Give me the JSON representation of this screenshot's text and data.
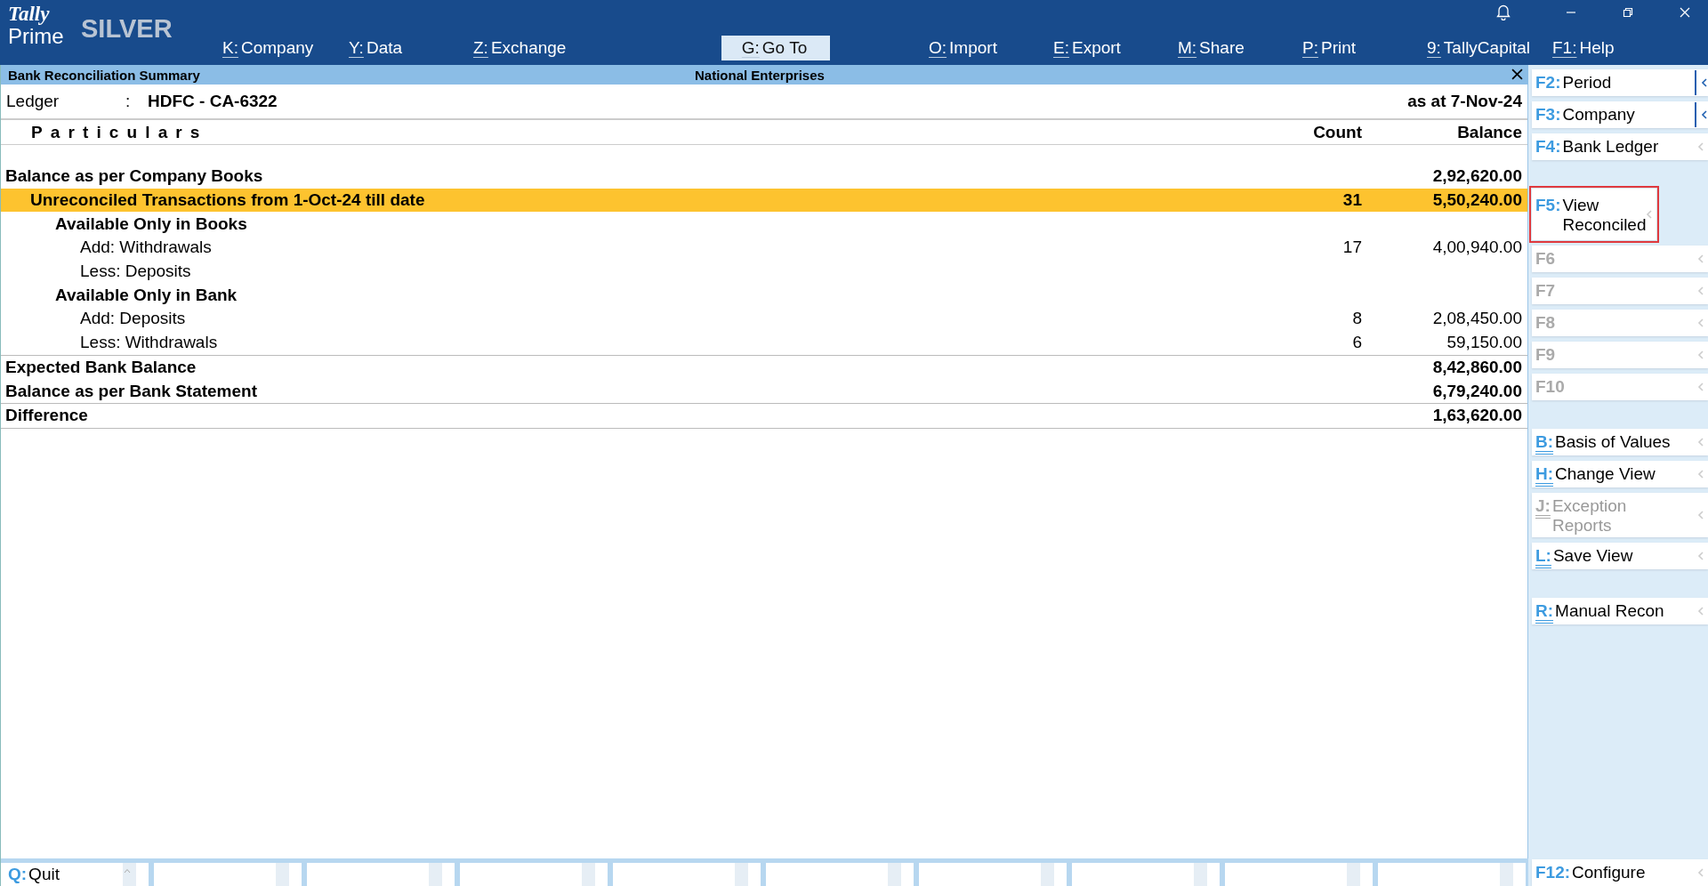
{
  "logo": {
    "brand": "Tally",
    "product": "Prime",
    "edition": "SILVER"
  },
  "top_menu": [
    {
      "key": "K:",
      "label": "Company",
      "selected": false
    },
    {
      "key": "Y:",
      "label": "Data",
      "selected": false
    },
    {
      "key": "Z:",
      "label": "Exchange",
      "selected": false
    },
    {
      "key": "G:",
      "label": "Go To",
      "selected": true
    },
    {
      "key": "O:",
      "label": "Import",
      "selected": false
    },
    {
      "key": "E:",
      "label": "Export",
      "selected": false
    },
    {
      "key": "M:",
      "label": "Share",
      "selected": false
    },
    {
      "key": "P:",
      "label": "Print",
      "selected": false
    },
    {
      "key": "9:",
      "label": "TallyCapital",
      "selected": false
    },
    {
      "key": "F1:",
      "label": "Help",
      "selected": false
    }
  ],
  "report": {
    "title": "Bank Reconciliation Summary",
    "company": "National Enterprises",
    "ledger_label": "Ledger",
    "ledger_separator": ":",
    "ledger_value": "HDFC - CA-6322",
    "as_at": "as at 7-Nov-24",
    "columns": [
      "Particulars",
      "Count",
      "Balance"
    ],
    "sections": [
      {
        "rows": [
          {
            "label": "Balance as per Company Books",
            "balance": "2,92,620.00",
            "selected": false,
            "children": [
              {
                "label": "Unreconciled Transactions from 1-Oct-24 till date",
                "count": "31",
                "balance": "5,50,240.00",
                "selected": true,
                "children": [
                  {
                    "label": "Available Only in Books",
                    "selected": false,
                    "children": [
                      {
                        "label": "Add: Withdrawals",
                        "count": "17",
                        "balance": "4,00,940.00",
                        "selected": false
                      },
                      {
                        "label": "Less: Deposits",
                        "selected": false
                      }
                    ]
                  },
                  {
                    "label": "Available Only in Bank",
                    "selected": false,
                    "children": [
                      {
                        "label": "Add: Deposits",
                        "count": "8",
                        "balance": "2,08,450.00",
                        "selected": false
                      },
                      {
                        "label": "Less: Withdrawals",
                        "count": "6",
                        "balance": "59,150.00",
                        "selected": false
                      }
                    ]
                  }
                ]
              }
            ]
          }
        ]
      },
      {
        "rows": [
          {
            "label": "Expected Bank Balance",
            "balance": "8,42,860.00",
            "selected": false
          },
          {
            "label": "Balance as per Bank Statement",
            "balance": "6,79,240.00",
            "selected": false
          }
        ]
      },
      {
        "rows": [
          {
            "label": "Difference",
            "balance": "1,63,620.00",
            "selected": false
          }
        ]
      }
    ]
  },
  "side_panel": [
    [
      {
        "key": "F2:",
        "label": "Period",
        "disabled": false,
        "expanded": true,
        "highlighted": false,
        "underline": false
      },
      {
        "key": "F3:",
        "label": "Company",
        "disabled": false,
        "expanded": true,
        "highlighted": false,
        "underline": false
      },
      {
        "key": "F4:",
        "label": "Bank Ledger",
        "disabled": false,
        "expanded": false,
        "highlighted": false,
        "underline": false
      }
    ],
    [
      {
        "key": "F5:",
        "label": "View Reconciled",
        "disabled": false,
        "expanded": false,
        "highlighted": true,
        "underline": false
      },
      {
        "key": "F6",
        "disabled": true,
        "expanded": false,
        "highlighted": false,
        "underline": false
      },
      {
        "key": "F7",
        "disabled": true,
        "expanded": false,
        "highlighted": false,
        "underline": false
      },
      {
        "key": "F8",
        "disabled": true,
        "expanded": false,
        "highlighted": false,
        "underline": false
      },
      {
        "key": "F9",
        "disabled": true,
        "expanded": false,
        "highlighted": false,
        "underline": false
      },
      {
        "key": "F10",
        "disabled": true,
        "expanded": false,
        "highlighted": false,
        "underline": false
      }
    ],
    [
      {
        "key": "B:",
        "label": "Basis of Values",
        "disabled": false,
        "expanded": false,
        "highlighted": false,
        "underline": true
      },
      {
        "key": "H:",
        "label": "Change View",
        "disabled": false,
        "expanded": false,
        "highlighted": false,
        "underline": true
      },
      {
        "key": "J:",
        "label": "Exception Reports",
        "disabled": true,
        "expanded": false,
        "highlighted": false,
        "underline": true
      },
      {
        "key": "L:",
        "label": "Save View",
        "disabled": false,
        "expanded": false,
        "highlighted": false,
        "underline": true
      }
    ],
    [
      {
        "key": "R:",
        "label": "Manual Recon",
        "disabled": false,
        "expanded": false,
        "highlighted": false,
        "underline": true
      }
    ]
  ],
  "bottom_bar": [
    {
      "key": "Q:",
      "label": "Quit"
    }
  ],
  "configure": {
    "key": "F12:",
    "label": "Configure"
  }
}
